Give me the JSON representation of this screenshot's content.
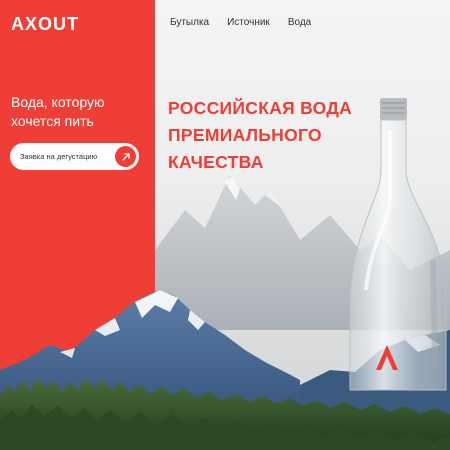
{
  "brand": {
    "logo": "AXOUT"
  },
  "nav": {
    "items": [
      "Бутылка",
      "Источник",
      "Вода"
    ]
  },
  "hero": {
    "tagline_line1": "Вода, которую",
    "tagline_line2": "хочется пить",
    "cta_label": "Заявка на дегустацию",
    "headline_line1": "РОССИЙСКАЯ ВОДА",
    "headline_line2": "ПРЕМИАЛЬНОГО",
    "headline_line3": "КАЧЕСТВА"
  },
  "colors": {
    "accent": "#ef3e36",
    "text_dark": "#333333",
    "white": "#ffffff"
  },
  "icons": {
    "cta": "arrow-icon"
  }
}
